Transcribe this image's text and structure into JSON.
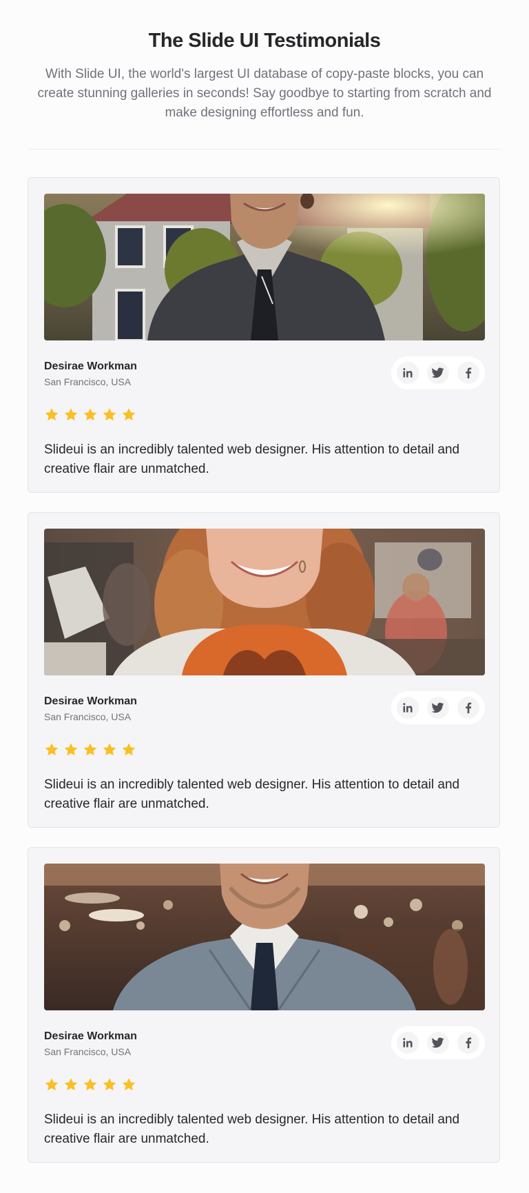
{
  "header": {
    "title": "The Slide UI Testimonials",
    "subtitle": "With Slide UI, the world's largest UI database of copy-paste blocks, you can create stunning galleries in seconds! Say goodbye to starting from scratch and make designing effortless and fun."
  },
  "colors": {
    "star": "#fbbf24",
    "card_background": "#f5f5f7",
    "social_icon": "#52525b"
  },
  "testimonials": [
    {
      "name": "Desirae Workman",
      "location": "San Francisco, USA",
      "rating": 5,
      "quote": "Slideui is an incredibly talented web designer. His attention to detail and creative flair are unmatched.",
      "photo": "smiling man in dark suit and tie in front of a house",
      "socials": [
        "linkedin-icon",
        "twitter-icon",
        "facebook-icon"
      ]
    },
    {
      "name": "Desirae Workman",
      "location": "San Francisco, USA",
      "rating": 5,
      "quote": "Slideui is an incredibly talented web designer. His attention to detail and creative flair are unmatched.",
      "photo": "smiling woman with curly auburn hair and orange scarf in a shop",
      "socials": [
        "linkedin-icon",
        "twitter-icon",
        "facebook-icon"
      ]
    },
    {
      "name": "Desirae Workman",
      "location": "San Francisco, USA",
      "rating": 5,
      "quote": "Slideui is an incredibly talented web designer. His attention to detail and creative flair are unmatched.",
      "photo": "smiling man in grey suit and navy tie with blurred bokeh background",
      "socials": [
        "linkedin-icon",
        "twitter-icon",
        "facebook-icon"
      ]
    }
  ]
}
